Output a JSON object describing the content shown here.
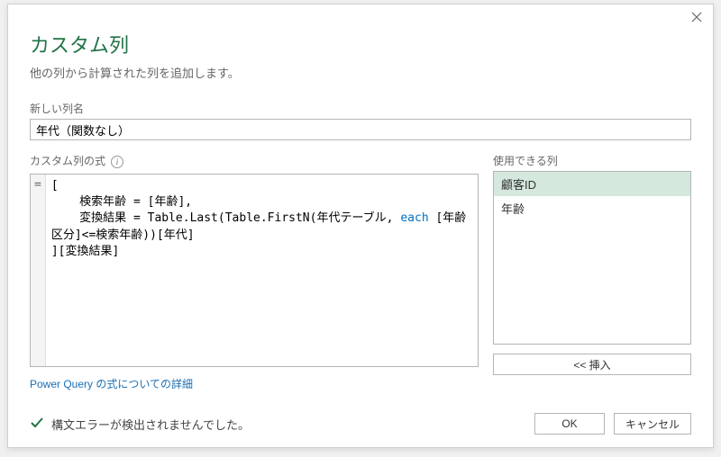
{
  "dialog": {
    "title": "カスタム列",
    "subtitle": "他の列から計算された列を追加します。"
  },
  "newColumn": {
    "label": "新しい列名",
    "value": "年代（関数なし）"
  },
  "formula": {
    "label": "カスタム列の式",
    "prefix": "=",
    "line1": "[",
    "line2_a": "    検索年齢 = [年齢],",
    "line3_a": "    変換結果 = Table.Last(Table.FirstN(年代テーブル, ",
    "line3_kw": "each",
    "line3_b": " [年齢区分]<=検索年齢))[年代]",
    "line4": "][変換結果]"
  },
  "available": {
    "label": "使用できる列",
    "items": [
      {
        "label": "顧客ID",
        "selected": true
      },
      {
        "label": "年齢",
        "selected": false
      }
    ]
  },
  "insert": {
    "label": "<< 挿入"
  },
  "link": {
    "label": "Power Query の式についての詳細"
  },
  "status": {
    "text": "構文エラーが検出されませんでした。"
  },
  "buttons": {
    "ok": "OK",
    "cancel": "キャンセル"
  }
}
